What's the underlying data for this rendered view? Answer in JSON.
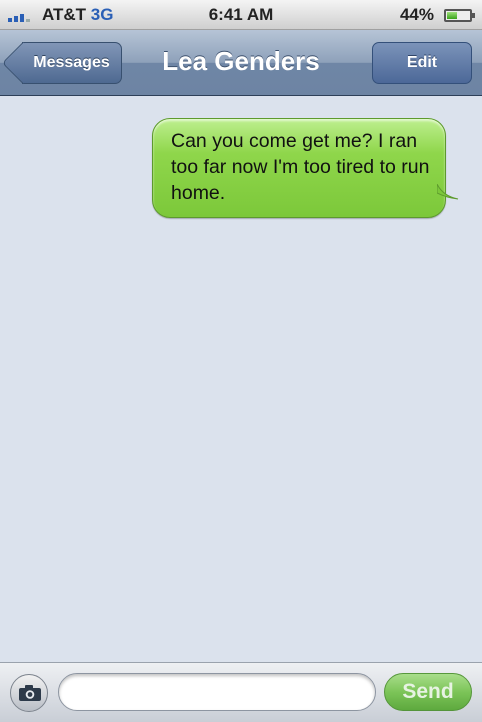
{
  "status_bar": {
    "carrier": "AT&T",
    "network": "3G",
    "time": "6:41 AM",
    "battery_percent": "44%",
    "battery_level": 0.44,
    "signal_bars": 3
  },
  "nav": {
    "back_label": "Messages",
    "title": "Lea Genders",
    "edit_label": "Edit"
  },
  "messages": [
    {
      "text": "Can you come get me? I ran too far now I'm too tired to run home.",
      "sender": "me"
    }
  ],
  "composer": {
    "input_value": "",
    "send_label": "Send",
    "camera_icon": "camera-icon"
  },
  "colors": {
    "sent_bubble": "#8fd64b",
    "nav_bar": "#6d84a3",
    "conversation_bg": "#dbe2ed",
    "network_text": "#2a5fb6"
  }
}
